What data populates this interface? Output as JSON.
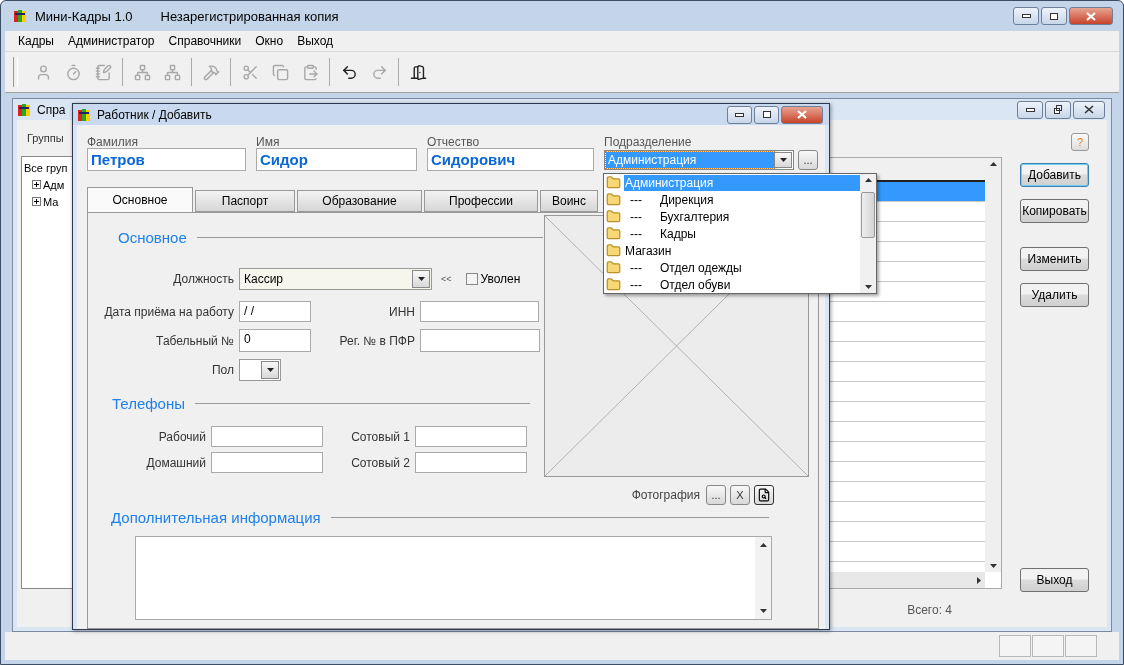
{
  "window": {
    "title": "Мини-Кадры 1.0",
    "subtitle": "Незарегистрированная копия"
  },
  "menu": [
    "Кадры",
    "Администратор",
    "Справочники",
    "Окно",
    "Выход"
  ],
  "toolbar": [
    {
      "kind": "user",
      "disabled": true
    },
    {
      "kind": "timer",
      "disabled": true
    },
    {
      "kind": "notes",
      "disabled": true
    },
    {
      "kind": "separator"
    },
    {
      "kind": "tree",
      "disabled": true
    },
    {
      "kind": "tree",
      "disabled": true
    },
    {
      "kind": "separator"
    },
    {
      "kind": "tools",
      "disabled": true
    },
    {
      "kind": "separator"
    },
    {
      "kind": "cut",
      "disabled": true
    },
    {
      "kind": "copy",
      "disabled": true
    },
    {
      "kind": "paste",
      "disabled": true
    },
    {
      "kind": "separator"
    },
    {
      "kind": "undo",
      "disabled": false
    },
    {
      "kind": "redo",
      "disabled": true
    },
    {
      "kind": "separator"
    },
    {
      "kind": "exit",
      "disabled": false
    }
  ],
  "directory_window": {
    "title": "Спра",
    "groups_label": "Группы",
    "tree": [
      {
        "label": "Все груп",
        "children": [
          {
            "label": "Адм",
            "expanded": false
          },
          {
            "label": "Ма",
            "expanded": false
          }
        ]
      }
    ],
    "help": "?",
    "list_rows": [
      {
        "selected": true
      },
      {
        "selected": false
      },
      {
        "selected": false
      },
      {
        "selected": false
      },
      {
        "selected": false
      },
      {
        "selected": false
      },
      {
        "selected": false
      },
      {
        "selected": false
      },
      {
        "selected": false
      },
      {
        "selected": false
      },
      {
        "selected": false
      },
      {
        "selected": false
      },
      {
        "selected": false
      },
      {
        "selected": false
      },
      {
        "selected": false
      },
      {
        "selected": false
      },
      {
        "selected": false
      },
      {
        "selected": false
      },
      {
        "selected": false
      }
    ],
    "button_groups": [
      [
        {
          "label": "Добавить",
          "default": true
        },
        {
          "label": "Копировать",
          "default": false
        }
      ],
      [
        {
          "label": "Изменить",
          "default": false
        },
        {
          "label": "Удалить",
          "default": false
        }
      ]
    ],
    "exit_button": "Выход",
    "total": "Всего: 4"
  },
  "dialog": {
    "title": "Работник / Добавить",
    "name_fields": [
      {
        "label": "Фамилия",
        "value": "Петров"
      },
      {
        "label": "Имя",
        "value": "Сидор"
      },
      {
        "label": "Отчество",
        "value": "Сидорович"
      }
    ],
    "department": {
      "label": "Подразделение",
      "value": "Администрация",
      "button": "..."
    },
    "tabs": [
      {
        "label": "Основное",
        "selected": true
      },
      {
        "label": "Паспорт",
        "selected": false
      },
      {
        "label": "Образование",
        "selected": false
      },
      {
        "label": "Профессии",
        "selected": false
      },
      {
        "label": "Воинс",
        "selected": false
      }
    ],
    "main_heading": "Основное",
    "position": {
      "label": "Должность",
      "value": "Кассир",
      "toggle": "<<"
    },
    "fired": {
      "label": "Уволен",
      "checked": false
    },
    "hire_date": {
      "label": "Дата приёма на работу",
      "value": "/ /"
    },
    "inn": {
      "label": "ИНН"
    },
    "tab_number": {
      "label": "Табельный №",
      "value": "0"
    },
    "pfr": {
      "label": "Рег. № в ПФР"
    },
    "gender": {
      "label": "Пол"
    },
    "phones_heading": "Телефоны",
    "phones": [
      [
        {
          "label": "Рабочий"
        },
        {
          "label": "Сотовый 1"
        }
      ],
      [
        {
          "label": "Домашний"
        },
        {
          "label": "Сотовый 2"
        }
      ]
    ],
    "photo": {
      "label": "Фотография",
      "browse": "...",
      "clear": "X"
    },
    "notes_heading": "Дополнительная информация",
    "department_list": [
      {
        "label": "Администрация",
        "selected": true
      },
      {
        "label": "Дирекция",
        "prefix": "---",
        "selected": false
      },
      {
        "label": "Бухгалтерия",
        "prefix": "---",
        "selected": false
      },
      {
        "label": "Кадры",
        "prefix": "---",
        "selected": false
      },
      {
        "label": "Магазин",
        "selected": false
      },
      {
        "label": "Отдел одежды",
        "prefix": "---",
        "selected": false
      },
      {
        "label": "Отдел обуви",
        "prefix": "---",
        "selected": false
      }
    ]
  }
}
